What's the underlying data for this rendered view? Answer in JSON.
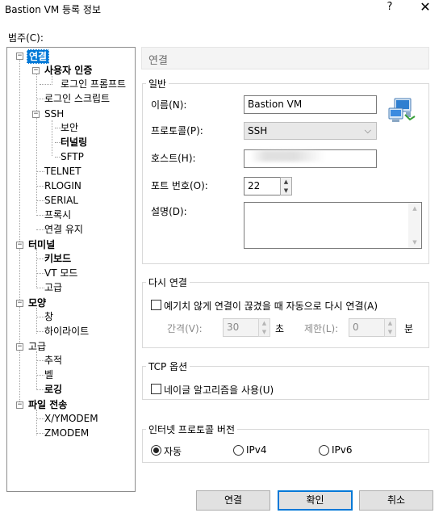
{
  "window": {
    "title": "Bastion VM 등록 정보",
    "help_glyph": "?",
    "close_glyph": "✕"
  },
  "category": {
    "label": "범주(C):",
    "tree": [
      {
        "label": "연결",
        "selected": true
      },
      {
        "label": "사용자 인증"
      },
      {
        "label": "로그인 프롬프트"
      },
      {
        "label": "로그인 스크립트"
      },
      {
        "label": "SSH"
      },
      {
        "label": "보안"
      },
      {
        "label": "터널링"
      },
      {
        "label": "SFTP"
      },
      {
        "label": "TELNET"
      },
      {
        "label": "RLOGIN"
      },
      {
        "label": "SERIAL"
      },
      {
        "label": "프록시"
      },
      {
        "label": "연결 유지"
      },
      {
        "label": "터미널"
      },
      {
        "label": "키보드"
      },
      {
        "label": "VT 모드"
      },
      {
        "label": "고급"
      },
      {
        "label": "모양"
      },
      {
        "label": "창"
      },
      {
        "label": "하이라이트"
      },
      {
        "label": "고급"
      },
      {
        "label": "추적"
      },
      {
        "label": "벨"
      },
      {
        "label": "로깅"
      },
      {
        "label": "파일 전송"
      },
      {
        "label": "X/YMODEM"
      },
      {
        "label": "ZMODEM"
      }
    ]
  },
  "panel": {
    "heading": "연결",
    "general": {
      "legend": "일반",
      "name_label": "이름(N):",
      "name_value": "Bastion VM",
      "protocol_label": "프로토콜(P):",
      "protocol_value": "SSH",
      "host_label": "호스트(H):",
      "host_value": "",
      "port_label": "포트 번호(O):",
      "port_value": "22",
      "desc_label": "설명(D):",
      "desc_value": ""
    },
    "reconnect": {
      "legend": "다시 연결",
      "checkbox_label": "예기치 않게 연결이 끊겼을 때 자동으로 다시 연결(A)",
      "interval_label": "간격(V):",
      "interval_value": "30",
      "interval_unit": "초",
      "limit_label": "제한(L):",
      "limit_value": "0",
      "limit_unit": "분"
    },
    "tcp": {
      "legend": "TCP 옵션",
      "nagle_label": "네이글 알고리즘을 사용(U)"
    },
    "ipversion": {
      "legend": "인터넷 프로토콜 버전",
      "options": [
        "자동",
        "IPv4",
        "IPv6"
      ],
      "selected": "자동"
    }
  },
  "buttons": {
    "connect": "연결",
    "ok": "확인",
    "cancel": "취소"
  },
  "icons": {
    "session_icon": "network-computers-icon"
  }
}
